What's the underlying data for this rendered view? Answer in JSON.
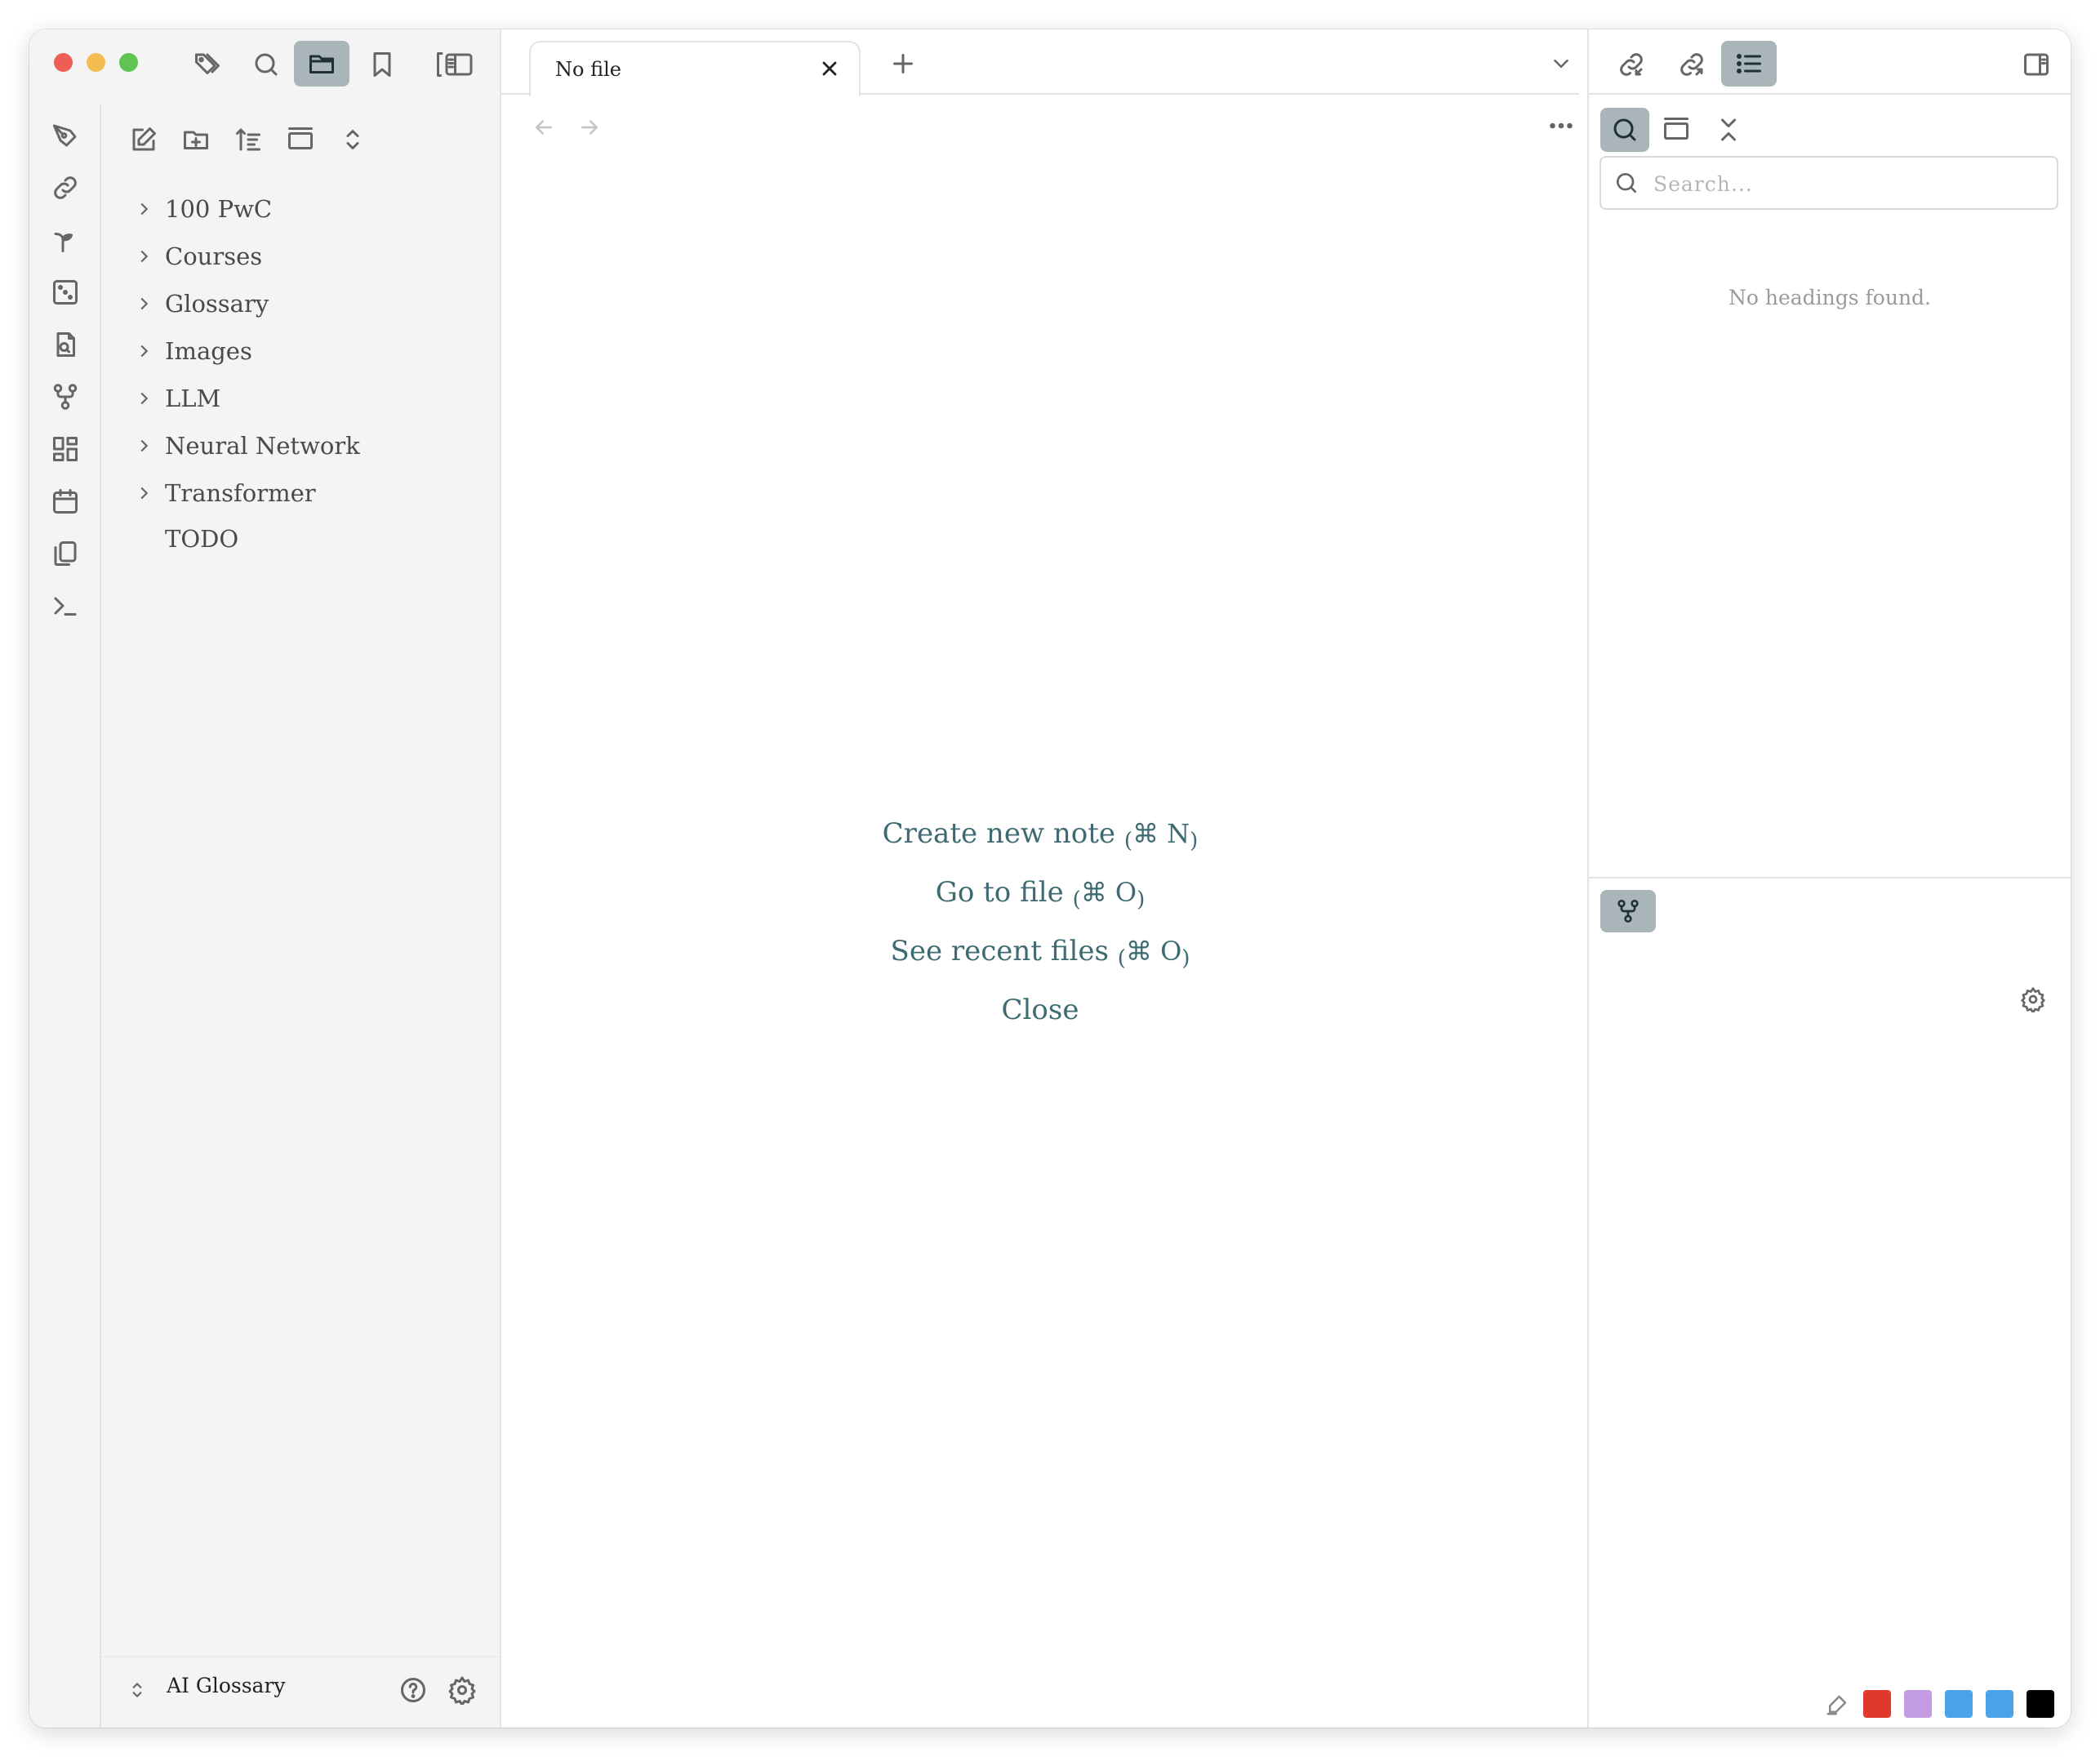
{
  "sidebar_toolbar": {
    "icons": [
      "tags-icon",
      "search-icon",
      "folder-icon",
      "bookmark-icon",
      "reading-view-icon"
    ]
  },
  "ribbon": {
    "icons": [
      "pen-tool-icon",
      "link-icon",
      "sprout-icon",
      "dice-icon",
      "file-search-icon",
      "git-fork-icon",
      "dashboard-icon",
      "calendar-icon",
      "copy-icon",
      "terminal-icon"
    ]
  },
  "file_explorer": {
    "actions": [
      "new-note-icon",
      "new-folder-icon",
      "sort-icon",
      "collapse-view-icon",
      "expand-collapse-icon"
    ],
    "items": [
      {
        "label": "100 PwC",
        "type": "folder"
      },
      {
        "label": "Courses",
        "type": "folder"
      },
      {
        "label": "Glossary",
        "type": "folder"
      },
      {
        "label": "Images",
        "type": "folder"
      },
      {
        "label": "LLM",
        "type": "folder"
      },
      {
        "label": "Neural Network",
        "type": "folder"
      },
      {
        "label": "Transformer",
        "type": "folder"
      },
      {
        "label": "TODO",
        "type": "file"
      }
    ]
  },
  "vault": {
    "name": "AI Glossary"
  },
  "tabs": [
    {
      "title": "No file",
      "active": true
    }
  ],
  "empty_state": {
    "create_note": {
      "label": "Create new note",
      "open": "(",
      "shortcut": "⌘ N",
      "close": ")"
    },
    "go_to_file": {
      "label": "Go to file",
      "open": "(",
      "shortcut": "⌘ O",
      "close": ")"
    },
    "recent_files": {
      "label": "See recent files",
      "open": "(",
      "shortcut": "⌘ O",
      "close": ")"
    },
    "close": {
      "label": "Close"
    }
  },
  "right_panel": {
    "search_placeholder": "Search...",
    "no_headings": "No headings found."
  },
  "highlight_colors": [
    "#e0392b",
    "#c39be3",
    "#4aa3e8",
    "#4aa3e8",
    "#000000"
  ],
  "colors": {
    "link_accent": "#3e6a72",
    "active_button": "#a9b5b8",
    "close_dot": "#ee5e55",
    "minimize_dot": "#f4bd4f",
    "zoom_dot": "#5fc452"
  }
}
